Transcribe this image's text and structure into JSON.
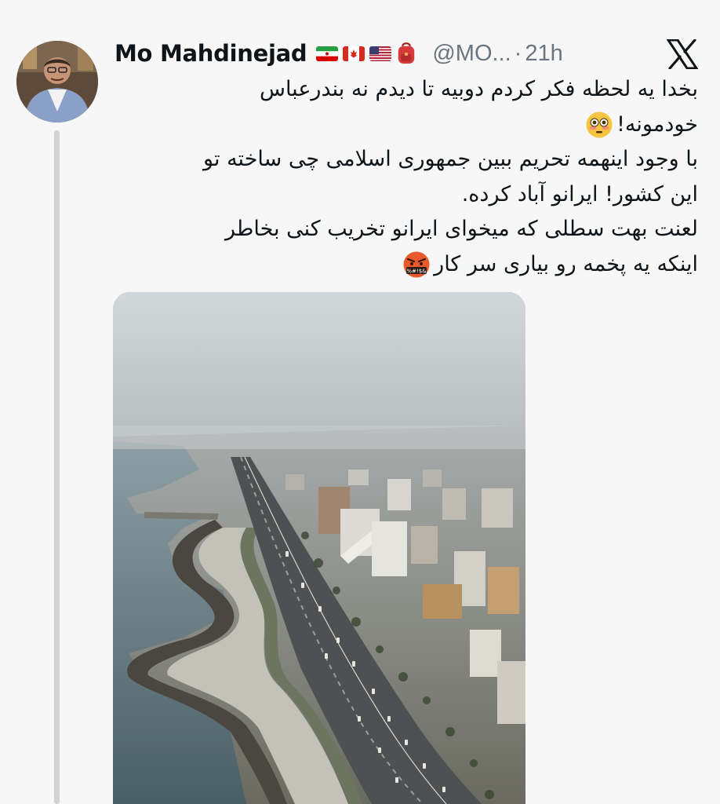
{
  "tweet": {
    "display_name": "Mo Mahdinejad",
    "handle": "@MO...",
    "separator": "·",
    "time": "21h",
    "flags": [
      "iran-flag-icon",
      "canada-flag-icon",
      "us-flag-icon",
      "backpack-icon"
    ],
    "text_lines": [
      "بخدا یه لحظه فکر کردم دوبیه تا دیدم نه بندرعباس",
      "خودمونه!",
      "با وجود اینهمه تحریم ببین جمهوری اسلامی چی ساخته تو",
      "این کشور! ایرانو آباد کرده.",
      "لعنت بهت سطلی که میخوای ایرانو تخریب کنی بخاطر",
      "اینکه یه پخمه رو بیاری سر کار"
    ],
    "emojis": {
      "line2": "flushed-face-emoji",
      "line6": "cursing-face-emoji"
    },
    "media": {
      "kind": "aerial-city-photo"
    }
  },
  "colors": {
    "background": "#f7f7f7",
    "text": "#0f1419",
    "muted": "#6b7580",
    "thread_line": "#cfd3d6"
  }
}
